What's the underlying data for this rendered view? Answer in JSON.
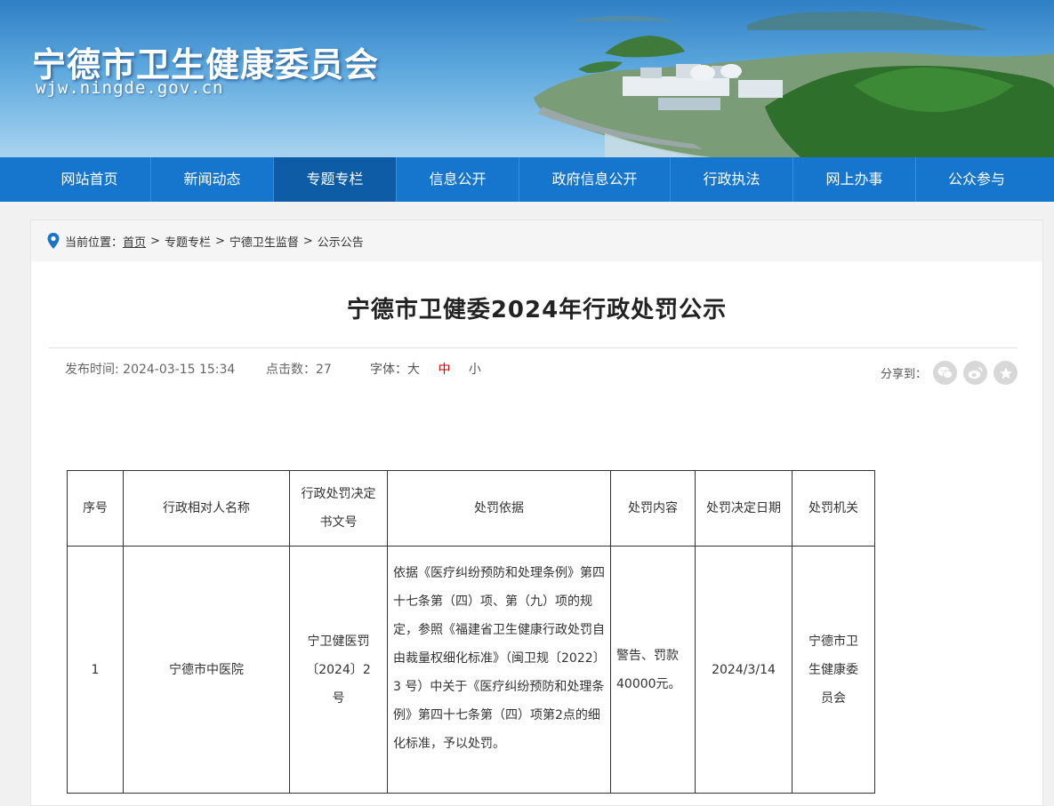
{
  "site": {
    "title": "宁德市卫生健康委员会",
    "domain": "wjw.ningde.gov.cn"
  },
  "nav": {
    "items": [
      {
        "label": "网站首页"
      },
      {
        "label": "新闻动态"
      },
      {
        "label": "专题专栏",
        "active": true
      },
      {
        "label": "信息公开"
      },
      {
        "label": "政府信息公开"
      },
      {
        "label": "行政执法"
      },
      {
        "label": "网上办事"
      },
      {
        "label": "公众参与"
      }
    ]
  },
  "breadcrumb": {
    "prefix": "当前位置：",
    "items": [
      "首页",
      "专题专栏",
      "宁德卫生监督",
      "公示公告"
    ]
  },
  "article": {
    "title": "宁德市卫健委2024年行政处罚公示",
    "publish_label": "发布时间:",
    "publish_time": "2024-03-15 15:34",
    "clicks_label": "点击数：",
    "clicks": "27",
    "font_label": "字体：",
    "font_large": "大",
    "font_medium": "中",
    "font_small": "小",
    "share_label": "分享到："
  },
  "share_icons": [
    "wechat-icon",
    "weibo-icon",
    "favorite-icon"
  ],
  "table": {
    "headers": [
      "序号",
      "行政相对人名称",
      "行政处罚决定书文号",
      "处罚依据",
      "处罚内容",
      "处罚决定日期",
      "处罚机关"
    ],
    "rows": [
      {
        "no": "1",
        "name": "宁德市中医院",
        "doc_no": "宁卫健医罚〔2024〕2号",
        "basis": "依据《医疗纠纷预防和处理条例》第四十七条第（四）项、第（九）项的规定，参照《福建省卫生健康行政处罚自由裁量权细化标准》（闽卫规〔2022〕3 号）中关于《医疗纠纷预防和处理条例》第四十七条第（四）项第2点的细化标准，予以处罚。",
        "content": "警告、罚款40000元。",
        "date": "2024/3/14",
        "authority": "宁德市卫生健康委员会"
      }
    ]
  },
  "colors": {
    "nav_bg": "#1675cc",
    "nav_active": "#0f5ca6",
    "font_current": "#d60000"
  }
}
